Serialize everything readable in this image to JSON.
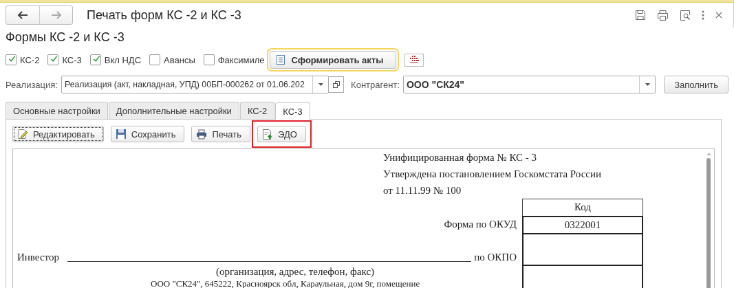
{
  "window": {
    "title": "Печать форм КС -2 и КС -3"
  },
  "form": {
    "heading": "Формы КС -2 и КС -3"
  },
  "options": [
    {
      "label": "КС-2",
      "checked": true
    },
    {
      "label": "КС-3",
      "checked": true
    },
    {
      "label": "Вкл НДС",
      "checked": true
    },
    {
      "label": "Авансы",
      "checked": false
    },
    {
      "label": "Факсимиле",
      "checked": false
    }
  ],
  "generate_button": {
    "label": "Сформировать акты",
    "focused": true
  },
  "realization": {
    "label": "Реализация:",
    "value": "Реализация (акт, накладная, УПД) 00БП-000262 от 01.06.202"
  },
  "counterparty": {
    "label": "Контрагент:",
    "value": "ООО \"СК24\""
  },
  "fill_button": {
    "label": "Заполнить"
  },
  "tabs": [
    {
      "label": "Основные настройки",
      "selected": false
    },
    {
      "label": "Дополнительные настройки",
      "selected": false
    },
    {
      "label": "КС-2",
      "selected": false
    },
    {
      "label": "КС-3",
      "selected": true
    }
  ],
  "toolbar": [
    {
      "label": "Редактировать",
      "kind": "edit",
      "focused": true,
      "highlighted": false
    },
    {
      "label": "Сохранить",
      "kind": "save",
      "focused": false,
      "highlighted": false
    },
    {
      "label": "Печать",
      "kind": "print",
      "focused": false,
      "highlighted": false
    },
    {
      "label": "ЭДО",
      "kind": "upload",
      "focused": false,
      "highlighted": true
    }
  ],
  "document": {
    "header_lines": [
      "Унифицированная форма № КС - 3",
      "Утверждена постановлением Госкомстата России",
      "от 11.11.99 № 100"
    ],
    "code_header": "Код",
    "okud_label": "Форма по ОКУД",
    "okud_code": "0322001",
    "investor_label": "Инвестор",
    "okpo_label": "по ОКПО",
    "investor_caption": "(организация, адрес, телефон, факс)",
    "investor_value": "ООО \"СК24\", 645222, Красноярск обл, Караульная, дом 9г, помещение"
  }
}
